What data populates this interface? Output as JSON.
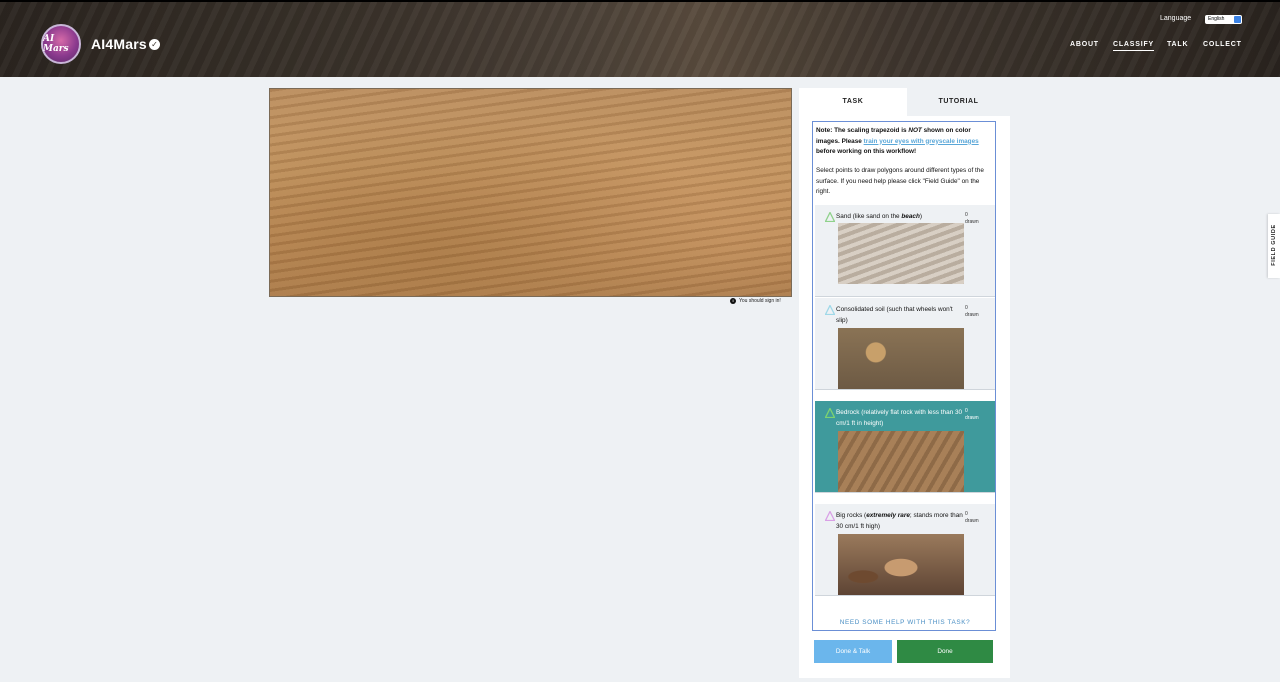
{
  "header": {
    "project_title": "AI4Mars",
    "avatar_text": "AI Mars",
    "language_label": "Language",
    "language_value": "English",
    "nav": [
      {
        "label": "ABOUT"
      },
      {
        "label": "CLASSIFY"
      },
      {
        "label": "TALK"
      },
      {
        "label": "COLLECT"
      }
    ]
  },
  "subject": {
    "signin_text": "You should sign in!"
  },
  "panel": {
    "tabs": [
      {
        "label": "TASK"
      },
      {
        "label": "TUTORIAL"
      }
    ],
    "note": {
      "part1": "Note: The scaling trapezoid is ",
      "emph": "NOT",
      "part2": " shown on color images. Please ",
      "link": "train your eyes with greyscale images",
      "part3": " before working on this workflow!"
    },
    "instructions": "Select points to draw polygons around different types of the surface. If you need help please click \"Field Guide\" on the right.",
    "options": [
      {
        "label_a": "Sand (like sand on the ",
        "label_b": "beach",
        "label_c": ")",
        "count": "0",
        "count_label": "drawn",
        "icon_color": "#8fd18b"
      },
      {
        "label_a": "Consolidated soil (such that wheels won't slip)",
        "label_b": "",
        "label_c": "",
        "count": "0",
        "count_label": "drawn",
        "icon_color": "#9fd8e8"
      },
      {
        "label_a": "Bedrock (relatively flat rock with less than 30 cm/1 ft in height)",
        "label_b": "",
        "label_c": "",
        "count": "0",
        "count_label": "drawn",
        "icon_color": "#7ed36f"
      },
      {
        "label_a": "Big rocks (",
        "label_b": "extremely rare",
        "label_c": "; stands more than 30 cm/1 ft high)",
        "count": "0",
        "count_label": "drawn",
        "icon_color": "#d9a0e6"
      }
    ],
    "help_link": "NEED SOME HELP WITH THIS TASK?",
    "done_talk": "Done & Talk",
    "done": "Done"
  },
  "field_guide": "FIELD GUIDE",
  "colors": {
    "selected_option": "#3f9a9c",
    "done_button": "#2f8a44",
    "done_talk_button": "#6bb6ec",
    "link": "#5aa7d8"
  }
}
